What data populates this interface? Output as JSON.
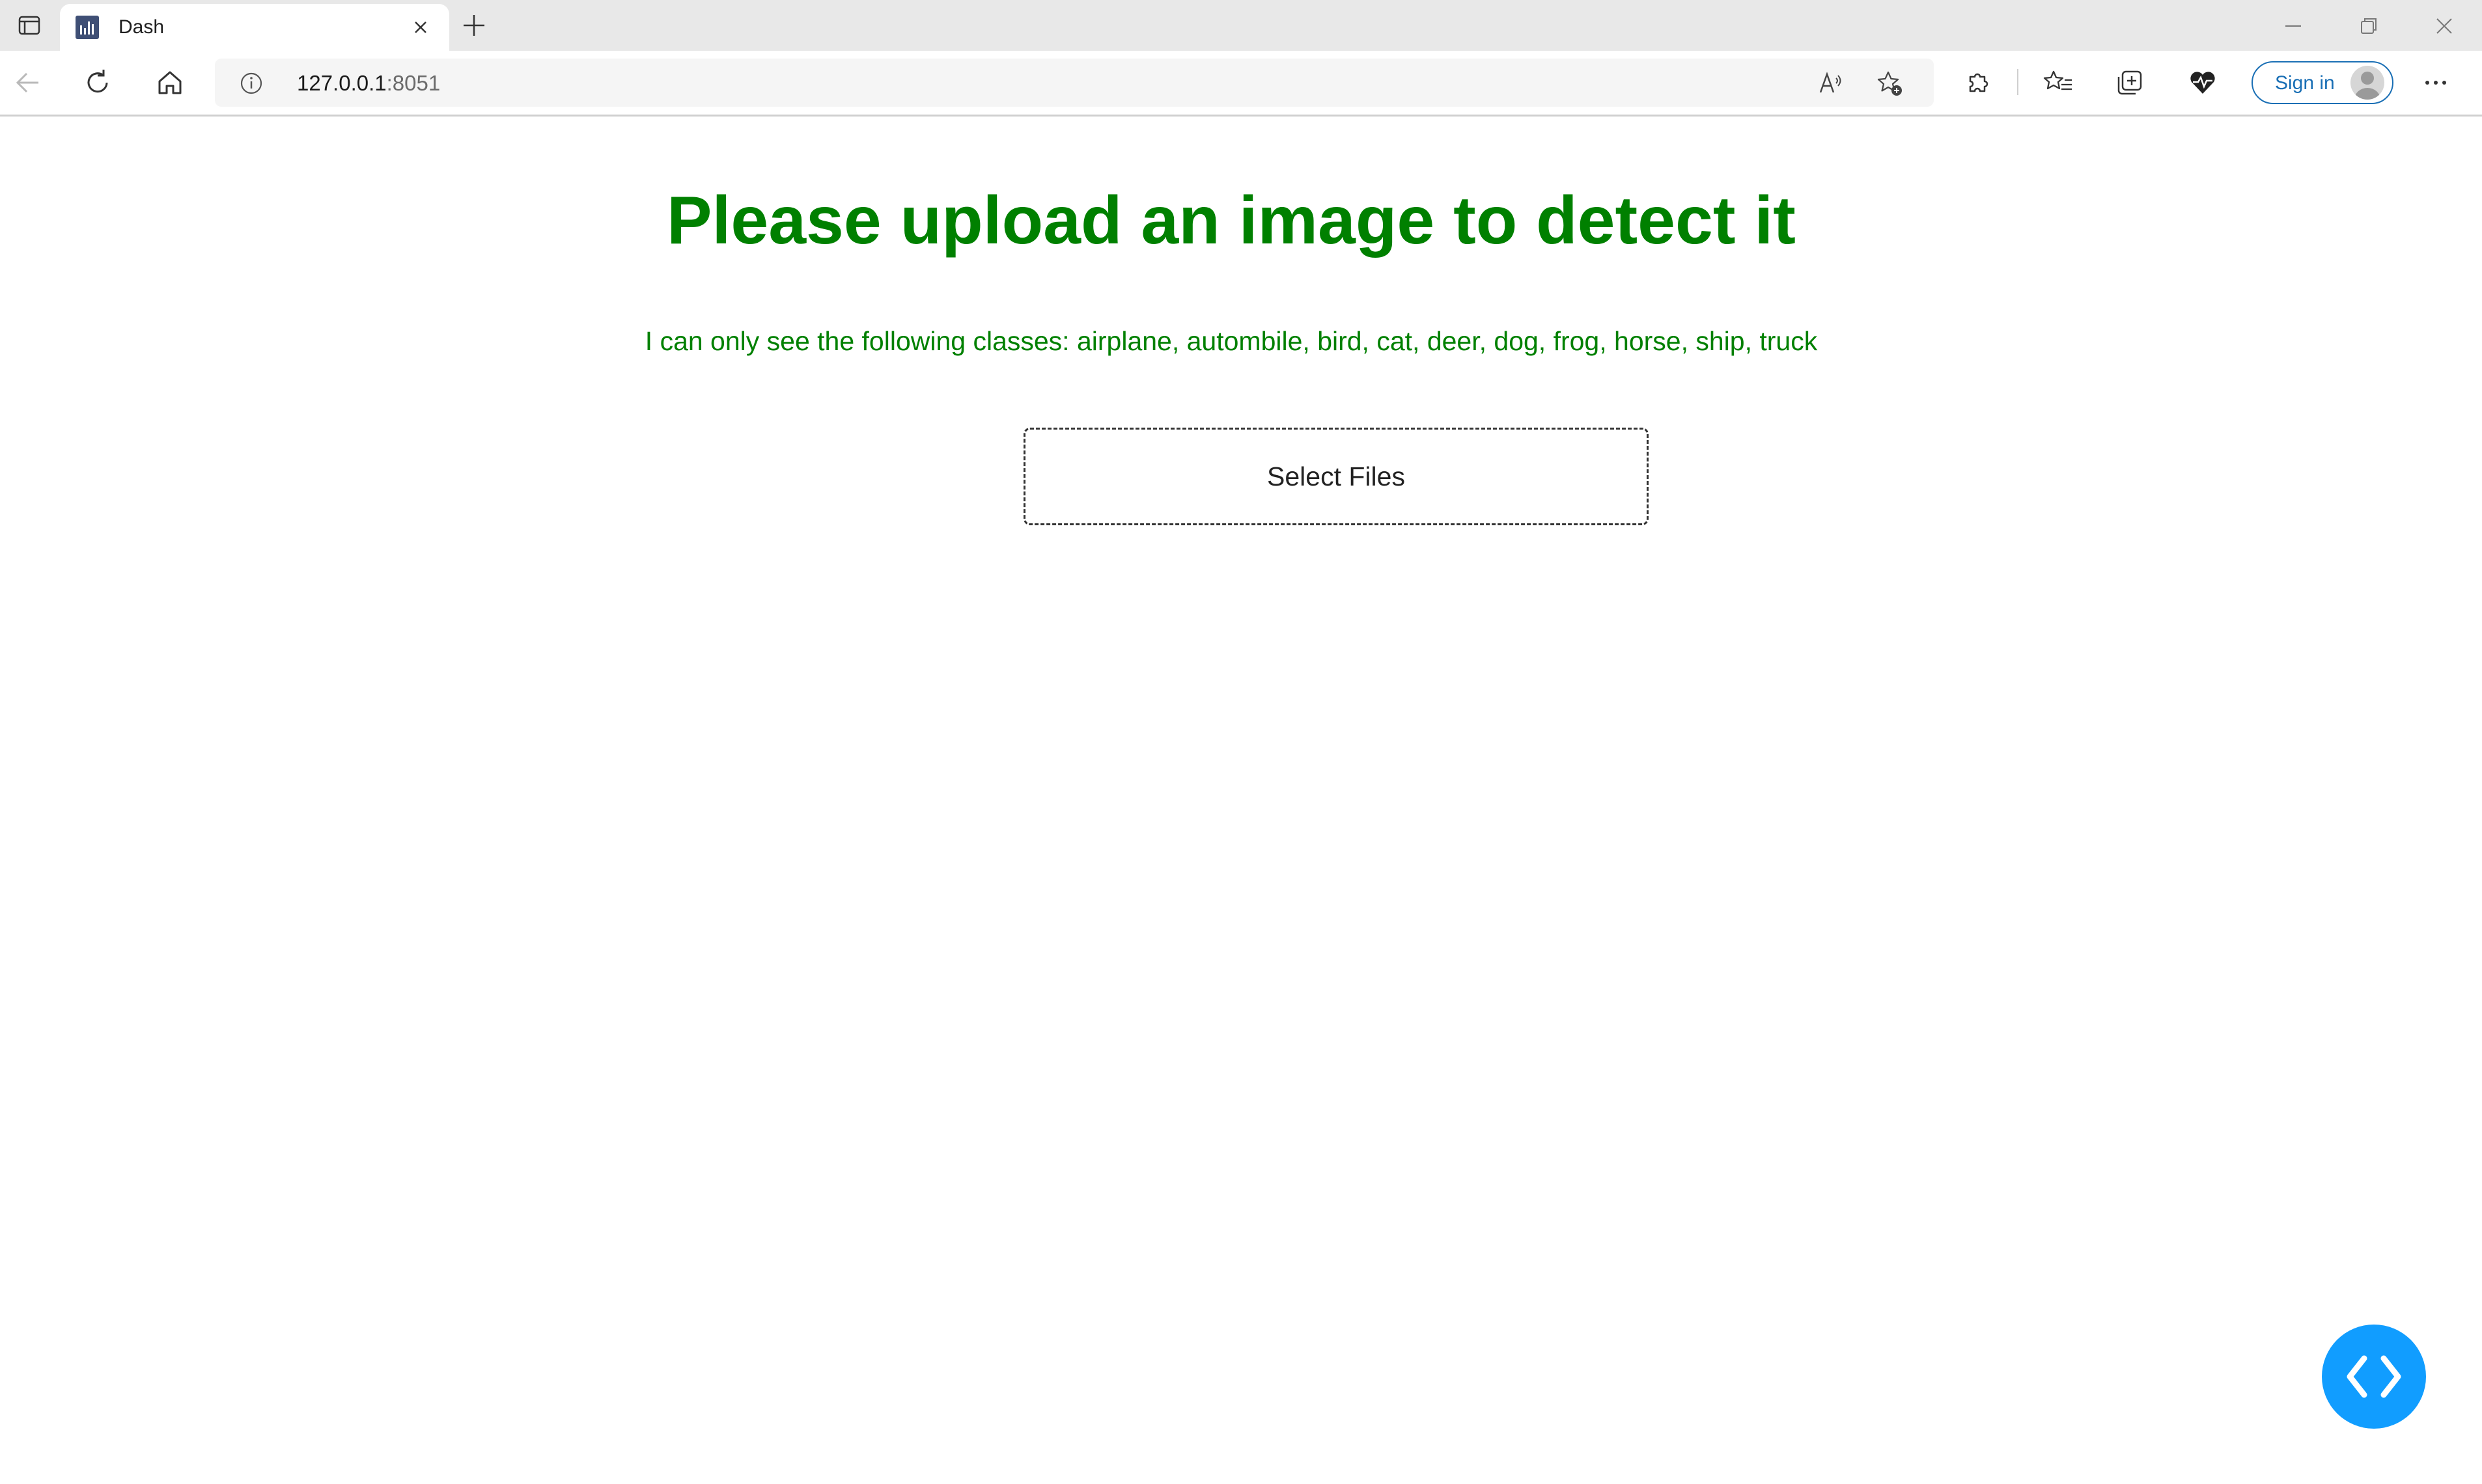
{
  "browser": {
    "tab": {
      "title": "Dash"
    },
    "address": {
      "host": "127.0.0.1",
      "port": ":8051"
    },
    "signin_label": "Sign in"
  },
  "page": {
    "heading": "Please upload an image to detect it",
    "subtitle": "I can only see the following classes: airplane, autombile, bird, cat, deer, dog, frog, horse, ship, truck",
    "upload_label": "Select Files"
  },
  "colors": {
    "heading": "#008000",
    "fab": "#119dff",
    "signin_border": "#1a6fb5"
  },
  "icons": [
    "tab-actions-icon",
    "dash-favicon",
    "close-icon",
    "plus-icon",
    "minimize-icon",
    "restore-icon",
    "window-close-icon",
    "back-arrow-icon",
    "refresh-icon",
    "home-icon",
    "info-icon",
    "read-aloud-icon",
    "add-favorite-icon",
    "extensions-icon",
    "favorites-icon",
    "collections-icon",
    "browser-essentials-icon",
    "avatar-icon",
    "more-icon",
    "code-chevrons-icon"
  ]
}
